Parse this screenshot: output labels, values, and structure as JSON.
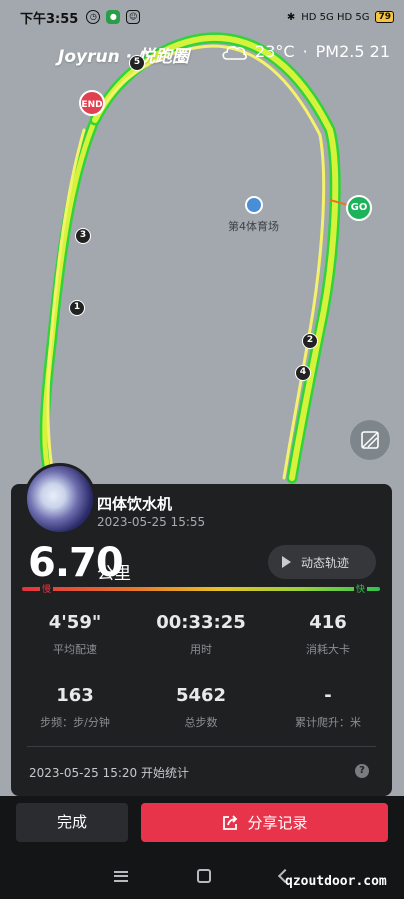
{
  "status_bar": {
    "time": "下午3:55",
    "right": "HD 5G HD 5G",
    "battery": "79"
  },
  "map": {
    "brand": "Joyrun · 悦跑圈",
    "weather": {
      "temp": "23°C",
      "sep": "·",
      "aqi": "PM2.5 21"
    },
    "pins": {
      "end": "END",
      "go": "GO"
    },
    "km_markers": [
      "1",
      "2",
      "3",
      "4",
      "5"
    ],
    "venue": "第4体育场",
    "route_colors": {
      "fast": "#2fd43c",
      "mid": "#d7f23a",
      "yellow": "#f4f26a"
    }
  },
  "user": {
    "name": "四体饮水机",
    "datetime": "2023-05-25 15:55"
  },
  "summary": {
    "distance": "6.70",
    "distance_unit": "公里",
    "replay": "动态轨迹",
    "pace_slow": "慢",
    "pace_fast": "快"
  },
  "stats": [
    {
      "value": "4'59\"",
      "label": "平均配速"
    },
    {
      "value": "00:33:25",
      "label": "用时"
    },
    {
      "value": "416",
      "label": "消耗大卡"
    },
    {
      "value": "163",
      "label": "步频：步/分钟"
    },
    {
      "value": "5462",
      "label": "总步数"
    },
    {
      "value": "-",
      "label": "累计爬升：米"
    }
  ],
  "start": "2023-05-25 15:20  开始统计",
  "help": "?",
  "actions": {
    "done": "完成",
    "share": "分享记录"
  },
  "watermark": "qzoutdoor.com"
}
